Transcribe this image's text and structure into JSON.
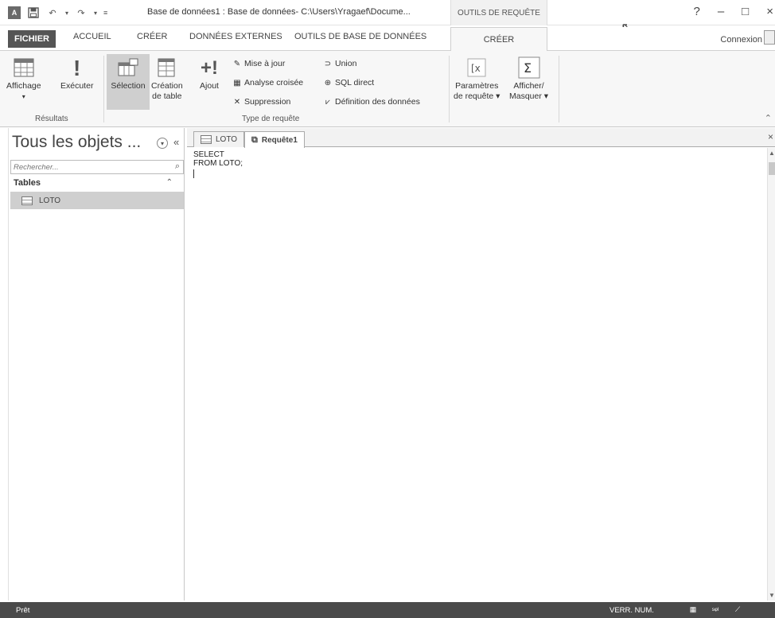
{
  "titlebar": {
    "doc_title": "Base de données1 : Base de données- C:\\Users\\Yragaef\\Docume...",
    "context_title": "OUTILS DE REQUÊTE",
    "window_controls": [
      "?",
      "–",
      "□",
      "×"
    ]
  },
  "tabs": {
    "fichier": "FICHIER",
    "accueil": "ACCUEIL",
    "creer": "CRÉER",
    "donnees_externes": "DONNÉES EXTERNES",
    "outils_bdd": "OUTILS DE BASE DE DONNÉES",
    "active": "CRÉER",
    "connexion": "Connexion"
  },
  "ribbon": {
    "affichage": "Affichage",
    "executer": "Exécuter",
    "resultats_group": "Résultats",
    "selection": "Sélection",
    "creation_line1": "Création",
    "creation_line2": "de table",
    "ajout": "Ajout",
    "mise_a_jour": "Mise à jour",
    "analyse_croisee": "Analyse croisée",
    "suppression": "Suppression",
    "union": "Union",
    "sql_direct": "SQL direct",
    "definition_donnees": "Définition des données",
    "type_requete_group": "Type de requête",
    "parametres_line1": "Paramètres",
    "parametres_line2": "de requête ▾",
    "afficher_line1": "Afficher/",
    "afficher_line2": "Masquer ▾"
  },
  "nav": {
    "title": "Tous les objets ...",
    "search_placeholder": "Rechercher...",
    "group_label": "Tables",
    "items": [
      "LOTO"
    ]
  },
  "documents": {
    "tabs": [
      "LOTO",
      "Requête1"
    ],
    "sql_text": "SELECT\nFROM LOTO;"
  },
  "status": {
    "ready": "Prêt",
    "verr_num": "VERR. NUM."
  }
}
